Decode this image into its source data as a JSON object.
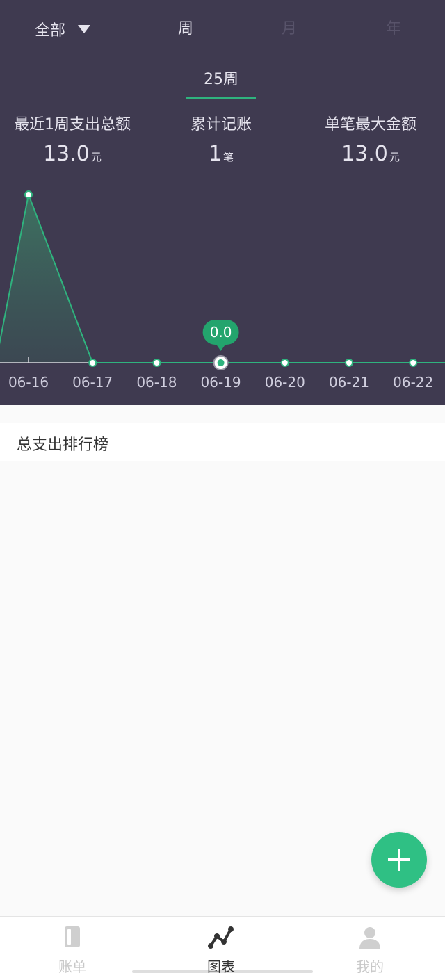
{
  "filter": {
    "selected": "全部"
  },
  "period_tabs": {
    "week": "周",
    "month": "月",
    "year": "年"
  },
  "week_label": "25周",
  "stats": {
    "total": {
      "label": "最近1周支出总额",
      "value": "13.0",
      "unit": "元"
    },
    "count": {
      "label": "累计记账",
      "value": "1",
      "unit": "笔"
    },
    "max": {
      "label": "单笔最大金额",
      "value": "13.0",
      "unit": "元"
    }
  },
  "chart_data": {
    "type": "area",
    "categories": [
      "06-16",
      "06-17",
      "06-18",
      "06-19",
      "06-20",
      "06-21",
      "06-22"
    ],
    "values": [
      13.0,
      0,
      0,
      0,
      0,
      0,
      0
    ],
    "selected_index": 3,
    "tooltip": "0.0",
    "colors": {
      "line": "#2fb37e",
      "fill": "#3d6b5e",
      "axis": "#d9d9e0"
    }
  },
  "ranking": {
    "title": "总支出排行榜"
  },
  "fab": {
    "icon": "plus-icon"
  },
  "tabbar": {
    "bill": {
      "label": "账单",
      "icon": "book-icon"
    },
    "chart": {
      "label": "图表",
      "icon": "chart-line-icon"
    },
    "me": {
      "label": "我的",
      "icon": "user-icon"
    }
  },
  "colors": {
    "header_bg": "#3f3a50",
    "accent": "#2fc084"
  }
}
